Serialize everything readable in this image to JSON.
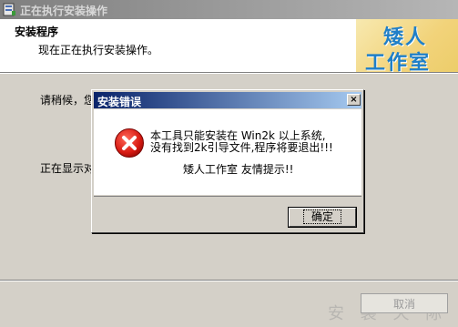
{
  "window": {
    "title": "正在执行安装操作",
    "header_title": "安装程序",
    "header_subtitle": "现在正在执行安装操作。",
    "logo_line1": "矮人",
    "logo_line2": "工作室",
    "wait_text": "请稍候，您",
    "progress_text": "正在显示对",
    "cancel_label": "取消",
    "watermark": "安 装 天 际"
  },
  "dialog": {
    "title": "安装错误",
    "close_glyph": "×",
    "message_line1": "本工具只能安装在 Win2k 以上系统,",
    "message_line2": "没有找到2k引导文件,程序将要退出!!!",
    "message_line3": "矮人工作室  友情提示!!",
    "ok_label": "确定",
    "icon": "error-icon"
  }
}
